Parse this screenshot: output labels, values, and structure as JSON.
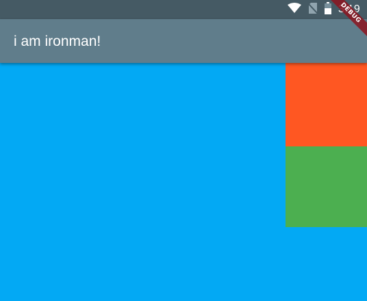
{
  "status_bar": {
    "time": "3:19",
    "icons": [
      "wifi-icon",
      "no-sim-icon",
      "battery-icon"
    ],
    "background": "#455a64"
  },
  "app_bar": {
    "title": "i am ironman!",
    "background": "#607d8b"
  },
  "body": {
    "background": "#03a9f4",
    "boxes": [
      {
        "name": "orange-box",
        "color": "#ff5722"
      },
      {
        "name": "green-box",
        "color": "#4caf50"
      }
    ]
  },
  "debug_banner": {
    "label": "DEBUG"
  }
}
